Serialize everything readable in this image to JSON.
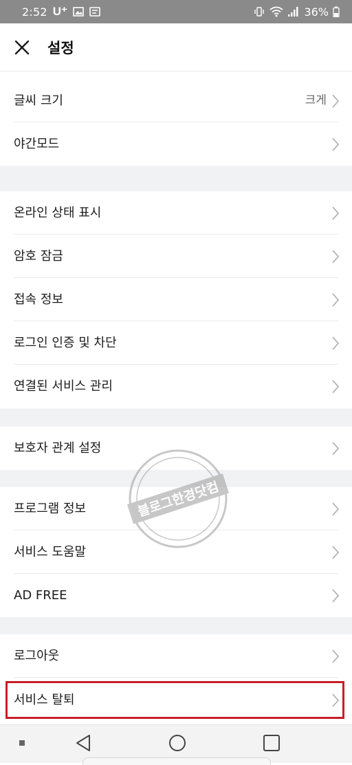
{
  "status_bar": {
    "time": "2:52",
    "carrier": "U⁺",
    "battery_percent": "36%"
  },
  "header": {
    "title": "설정",
    "close_icon": "close-icon"
  },
  "sections": [
    {
      "items": [
        {
          "label": "글씨 크기",
          "value": "크게"
        },
        {
          "label": "야간모드",
          "value": ""
        }
      ]
    },
    {
      "items": [
        {
          "label": "온라인 상태 표시"
        },
        {
          "label": "암호 잠금"
        },
        {
          "label": "접속 정보"
        },
        {
          "label": "로그인 인증 및 차단"
        },
        {
          "label": "연결된 서비스 관리"
        }
      ]
    },
    {
      "items": [
        {
          "label": "보호자 관계 설정"
        }
      ]
    },
    {
      "items": [
        {
          "label": "프로그램 정보"
        },
        {
          "label": "서비스 도움말"
        },
        {
          "label": "AD FREE"
        }
      ]
    },
    {
      "items": [
        {
          "label": "로그아웃"
        },
        {
          "label": "서비스 탈퇴"
        }
      ]
    }
  ],
  "watermark": {
    "text": "블로그한경닷컴"
  },
  "colors": {
    "status_bar_bg": "#8a8a8a",
    "section_gap_bg": "#f1f2f4",
    "highlight_border": "#c81e28",
    "chevron": "#b5b5b5"
  }
}
